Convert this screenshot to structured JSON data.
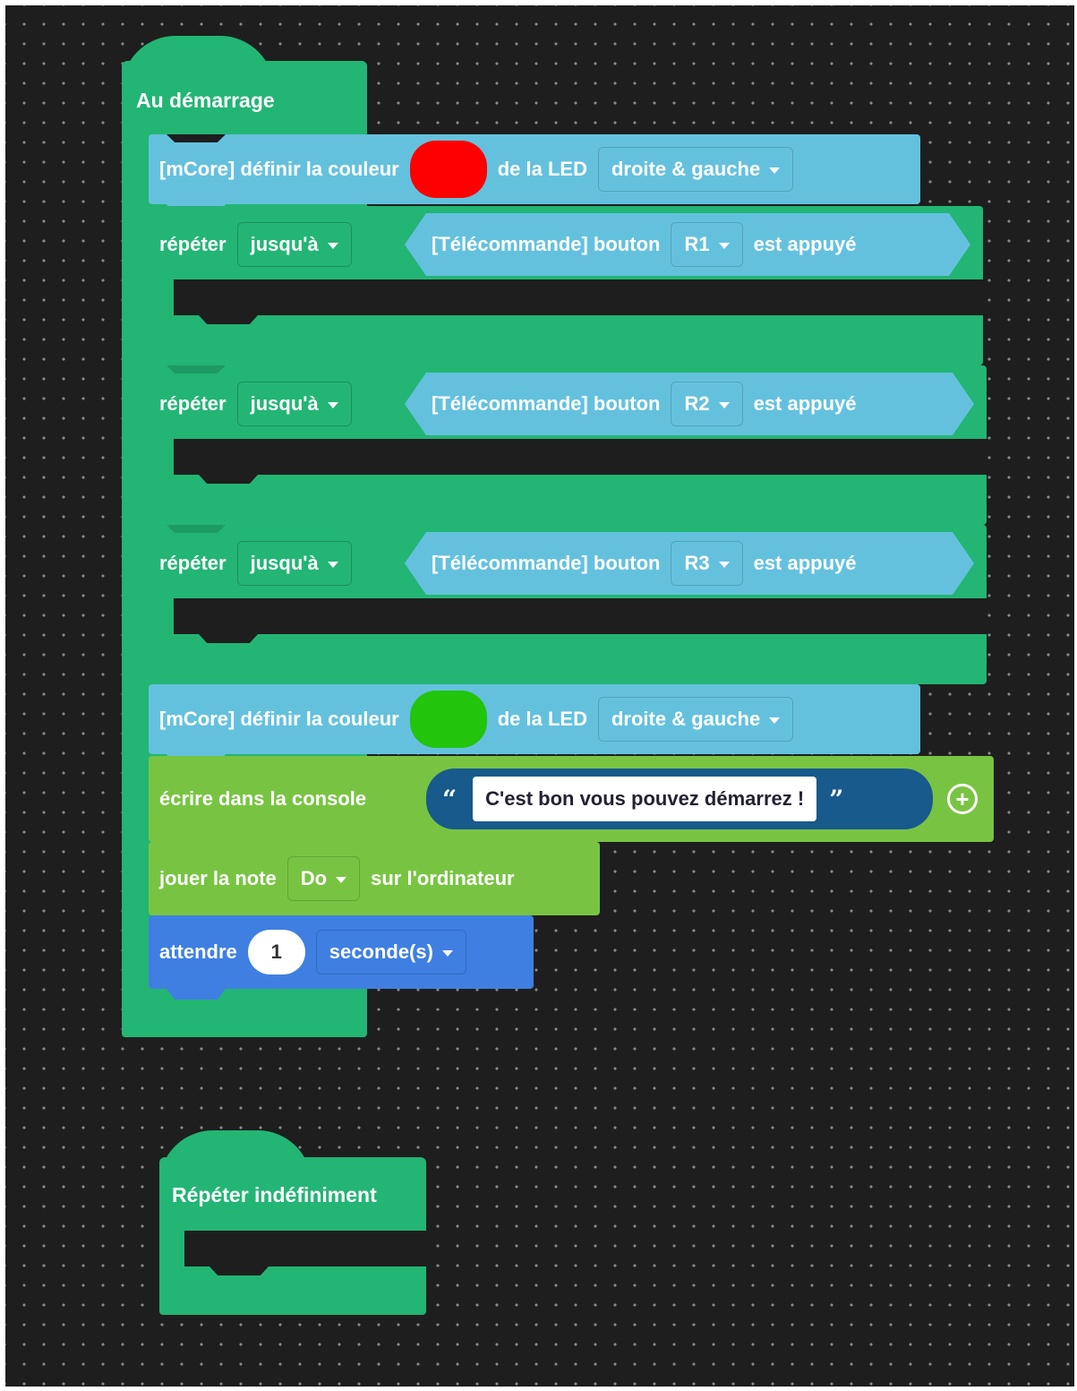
{
  "colors": {
    "workspace_bg": "#1e1e1e",
    "control_green": "#23b574",
    "mcore_blue": "#64c1de",
    "console_green": "#78c442",
    "wait_blue": "#3f7fe2",
    "led_red": "#ff0000",
    "led_green": "#22c40c"
  },
  "start_script": {
    "hat_label": "Au démarrage",
    "set_led_1": {
      "prefix": "[mCore] définir la couleur",
      "color": "#ff0000",
      "mid": "de la LED",
      "dropdown": "droite & gauche"
    },
    "repeat_blocks": [
      {
        "label": "répéter",
        "mode": "jusqu'à",
        "condition_prefix": "[Télécommande] bouton",
        "button": "R1",
        "condition_suffix": "est appuyé"
      },
      {
        "label": "répéter",
        "mode": "jusqu'à",
        "condition_prefix": "[Télécommande] bouton",
        "button": "R2",
        "condition_suffix": "est appuyé"
      },
      {
        "label": "répéter",
        "mode": "jusqu'à",
        "condition_prefix": "[Télécommande] bouton",
        "button": "R3",
        "condition_suffix": "est appuyé"
      }
    ],
    "set_led_2": {
      "prefix": "[mCore] définir la couleur",
      "color": "#22c40c",
      "mid": "de la LED",
      "dropdown": "droite & gauche"
    },
    "console_print": {
      "label": "écrire dans la console",
      "open_quote": "“",
      "text": "C'est bon vous pouvez démarrez !",
      "close_quote": "”",
      "add_icon": "plus-circle-icon"
    },
    "play_note": {
      "prefix": "jouer la note",
      "note": "Do",
      "suffix": "sur l'ordinateur"
    },
    "wait": {
      "label": "attendre",
      "value": "1",
      "unit": "seconde(s)"
    }
  },
  "forever_script": {
    "hat_label": "Répéter indéfiniment"
  }
}
